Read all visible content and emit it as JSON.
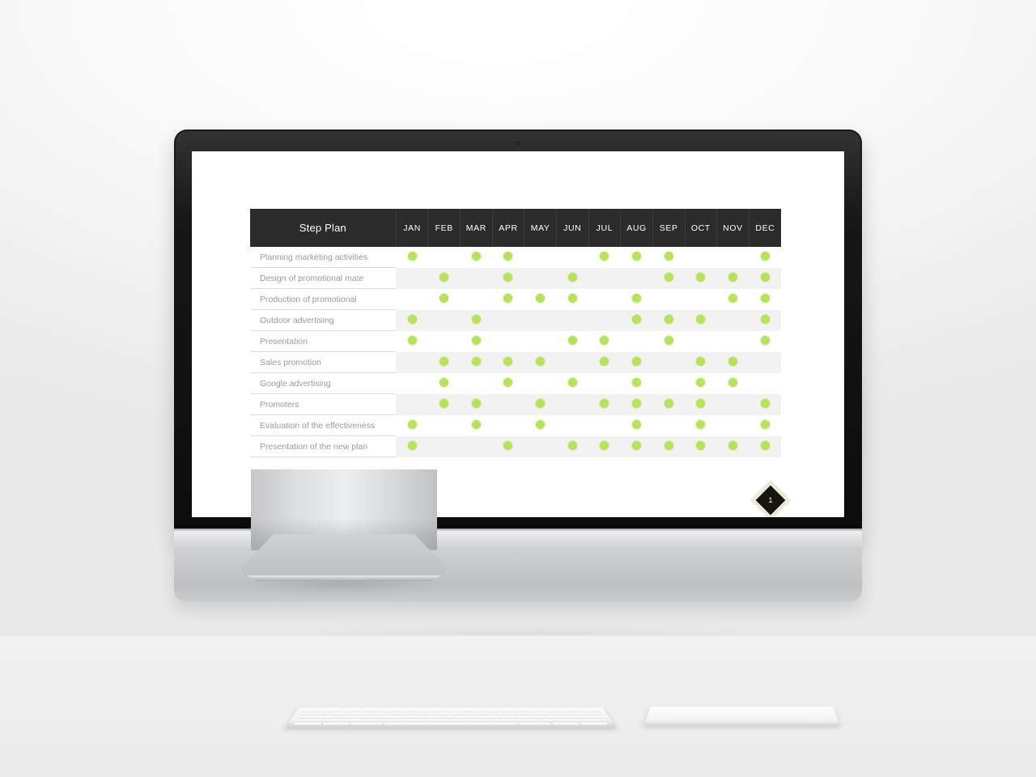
{
  "slide": {
    "page_number": "1",
    "table": {
      "label_header": "Step Plan",
      "months": [
        "JAN",
        "FEB",
        "MAR",
        "APR",
        "MAY",
        "JUN",
        "JUL",
        "AUG",
        "SEP",
        "OCT",
        "NOV",
        "DEC"
      ],
      "rows": [
        {
          "label": "Planning marketing activities",
          "marks": [
            1,
            0,
            1,
            1,
            0,
            0,
            1,
            1,
            1,
            0,
            0,
            1
          ]
        },
        {
          "label": "Design of promotional mate",
          "marks": [
            0,
            1,
            0,
            1,
            0,
            1,
            0,
            0,
            1,
            1,
            1,
            1
          ]
        },
        {
          "label": "Production of promotional",
          "marks": [
            0,
            1,
            0,
            1,
            1,
            1,
            0,
            1,
            0,
            0,
            1,
            1
          ]
        },
        {
          "label": "Outdoor advertising",
          "marks": [
            1,
            0,
            1,
            0,
            0,
            0,
            0,
            1,
            1,
            1,
            0,
            1
          ]
        },
        {
          "label": "Presentation",
          "marks": [
            1,
            0,
            1,
            0,
            0,
            1,
            1,
            0,
            1,
            0,
            0,
            1
          ]
        },
        {
          "label": "Sales promotion",
          "marks": [
            0,
            1,
            1,
            1,
            1,
            0,
            1,
            1,
            0,
            1,
            1,
            0
          ]
        },
        {
          "label": "Google advertising",
          "marks": [
            0,
            1,
            0,
            1,
            0,
            1,
            0,
            1,
            0,
            1,
            1,
            0
          ]
        },
        {
          "label": "Promoters",
          "marks": [
            0,
            1,
            1,
            0,
            1,
            0,
            1,
            1,
            1,
            1,
            0,
            1
          ]
        },
        {
          "label": "Evaluation of the effectiveness",
          "marks": [
            1,
            0,
            1,
            0,
            1,
            0,
            0,
            1,
            0,
            1,
            0,
            1
          ]
        },
        {
          "label": "Presentation of the new plan",
          "marks": [
            1,
            0,
            0,
            1,
            0,
            1,
            1,
            1,
            1,
            1,
            1,
            1
          ]
        }
      ]
    },
    "colors": {
      "header_bg": "#2b2b2b",
      "dot": "#b8e25a",
      "row_alt": "#f2f2f2",
      "label_text": "#9a9a9a",
      "badge_bg": "#16160f"
    }
  },
  "device": {
    "bezel_color": "#141414",
    "chin_color": "#c9cbcd"
  }
}
